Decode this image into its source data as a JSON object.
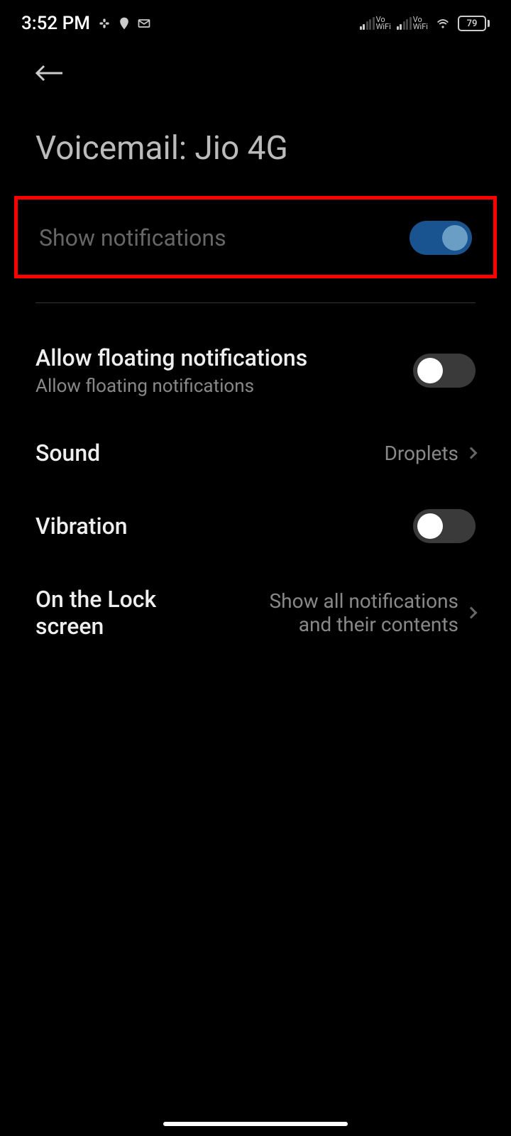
{
  "status": {
    "time": "3:52 PM",
    "vowifi_label": "Vo\nWiFi",
    "battery": "79"
  },
  "header": {
    "title": "Voicemail: Jio 4G"
  },
  "settings": {
    "show_notifications": {
      "label": "Show notifications",
      "enabled": true
    },
    "floating": {
      "label": "Allow floating notifications",
      "sublabel": "Allow floating notifications",
      "enabled": false
    },
    "sound": {
      "label": "Sound",
      "value": "Droplets"
    },
    "vibration": {
      "label": "Vibration",
      "enabled": false
    },
    "lockscreen": {
      "label": "On the Lock screen",
      "value": "Show all notifications and their contents"
    }
  }
}
